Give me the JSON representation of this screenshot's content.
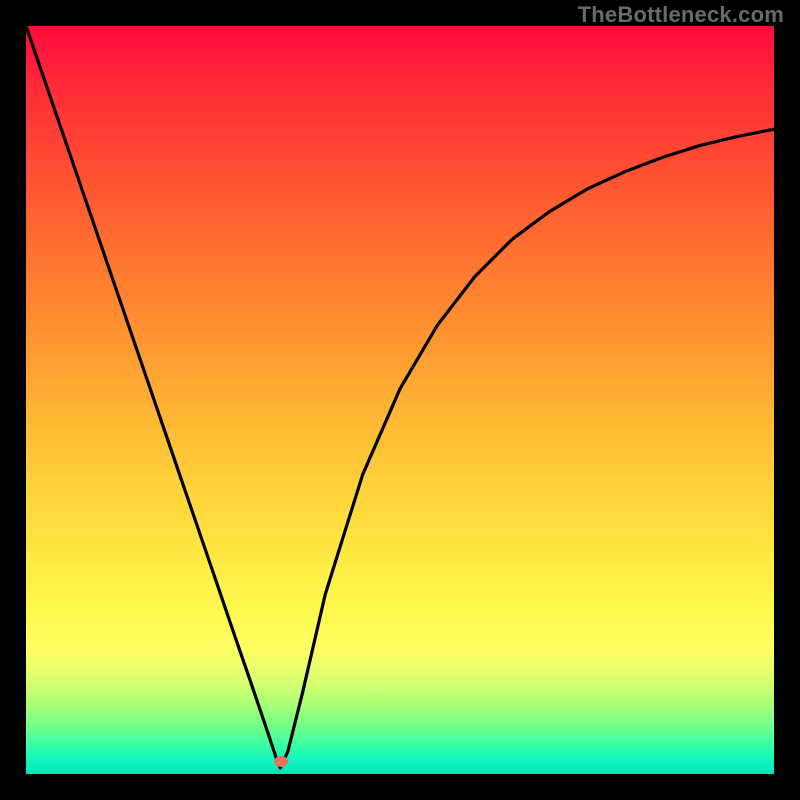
{
  "watermark": "TheBottleneck.com",
  "chart_data": {
    "type": "line",
    "title": "",
    "xlabel": "",
    "ylabel": "",
    "xlim": [
      0,
      100
    ],
    "ylim": [
      0,
      100
    ],
    "series": [
      {
        "name": "curve",
        "x": [
          0,
          5,
          10,
          15,
          20,
          25,
          28,
          30,
          32,
          33.5,
          34,
          35,
          37,
          40,
          45,
          50,
          55,
          60,
          65,
          70,
          75,
          80,
          85,
          90,
          95,
          100
        ],
        "y": [
          100,
          85.4,
          70.8,
          56.2,
          41.6,
          27.0,
          18.2,
          12.4,
          6.5,
          2.0,
          0.8,
          3.0,
          11.0,
          24.0,
          40.0,
          51.5,
          60.0,
          66.5,
          71.5,
          75.2,
          78.2,
          80.5,
          82.4,
          84.0,
          85.2,
          86.2
        ]
      }
    ],
    "marker": {
      "x": 34,
      "y": 1.2,
      "color": "#e2735e"
    },
    "background_gradient": {
      "top": "#ff0b3d",
      "bottom": "#00e6b3"
    }
  }
}
